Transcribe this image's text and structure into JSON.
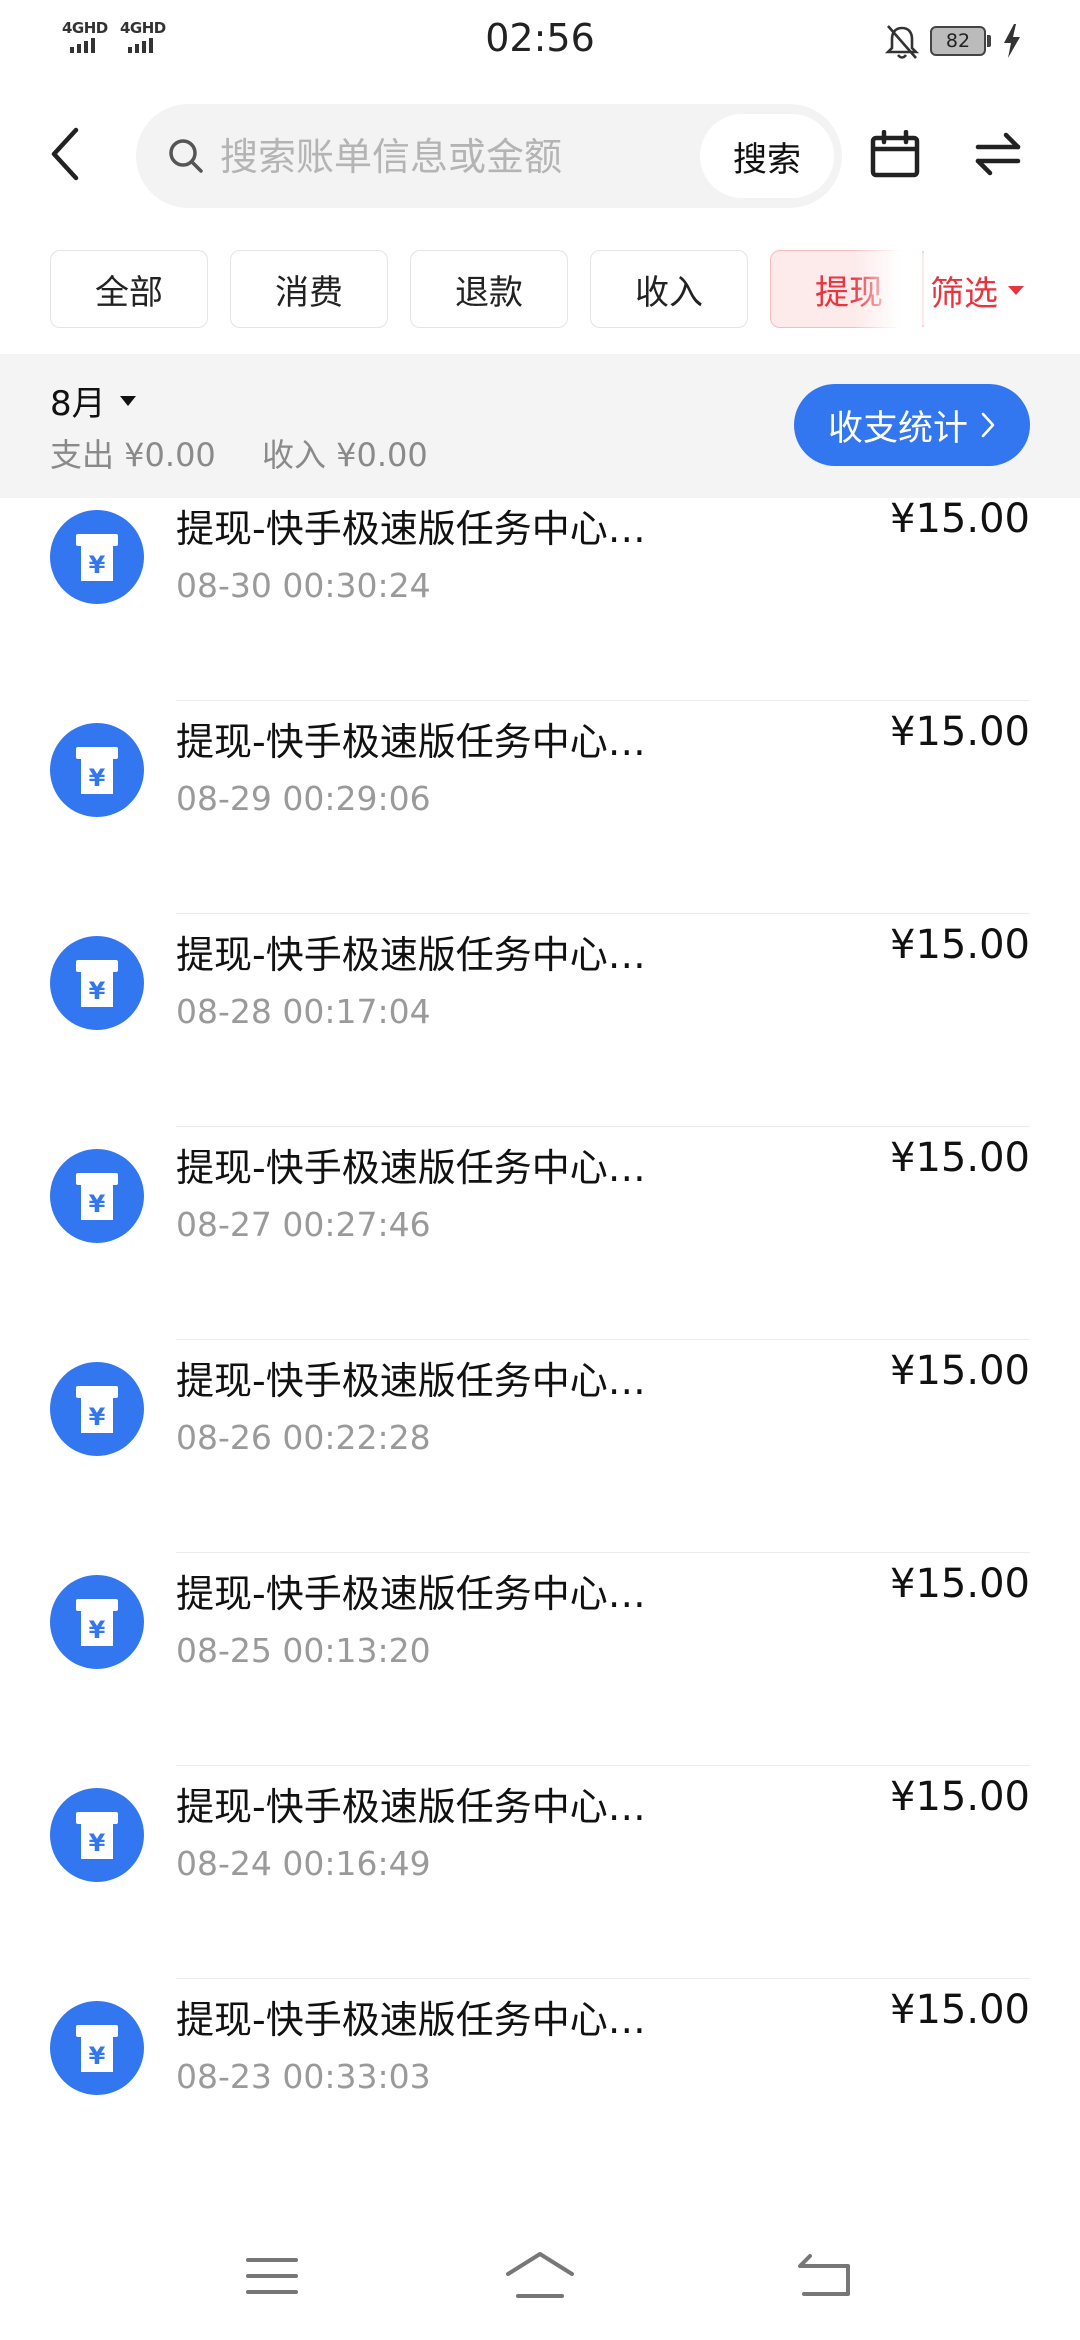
{
  "status_bar": {
    "time": "02:56",
    "signal1": "4GHD",
    "signal2": "4GHD",
    "battery": "82"
  },
  "search": {
    "placeholder": "搜索账单信息或金额",
    "button_label": "搜索"
  },
  "tabs": [
    {
      "label": "全部",
      "active": false
    },
    {
      "label": "消费",
      "active": false
    },
    {
      "label": "退款",
      "active": false
    },
    {
      "label": "收入",
      "active": false
    },
    {
      "label": "提现",
      "active": true
    }
  ],
  "filter_label": "筛选",
  "summary": {
    "month": "8月",
    "expense": "支出 ¥0.00",
    "income": "收入 ¥0.00",
    "stats_button": "收支统计"
  },
  "transactions": [
    {
      "title": "提现-快手极速版任务中心…",
      "time": "08-30 00:30:24",
      "amount": "¥15.00"
    },
    {
      "title": "提现-快手极速版任务中心…",
      "time": "08-29 00:29:06",
      "amount": "¥15.00"
    },
    {
      "title": "提现-快手极速版任务中心…",
      "time": "08-28 00:17:04",
      "amount": "¥15.00"
    },
    {
      "title": "提现-快手极速版任务中心…",
      "time": "08-27 00:27:46",
      "amount": "¥15.00"
    },
    {
      "title": "提现-快手极速版任务中心…",
      "time": "08-26 00:22:28",
      "amount": "¥15.00"
    },
    {
      "title": "提现-快手极速版任务中心…",
      "time": "08-25 00:13:20",
      "amount": "¥15.00"
    },
    {
      "title": "提现-快手极速版任务中心…",
      "time": "08-24 00:16:49",
      "amount": "¥15.00"
    },
    {
      "title": "提现-快手极速版任务中心…",
      "time": "08-23 00:33:03",
      "amount": "¥15.00"
    }
  ],
  "colors": {
    "accent_blue": "#3276f0",
    "accent_red": "#e8343d",
    "summary_bg": "#f4f4f5"
  },
  "icons": {
    "transaction": "withdraw-yuan-icon",
    "back": "chevron-left-icon",
    "search": "search-icon",
    "calendar": "calendar-icon",
    "swap": "swap-arrows-icon"
  }
}
